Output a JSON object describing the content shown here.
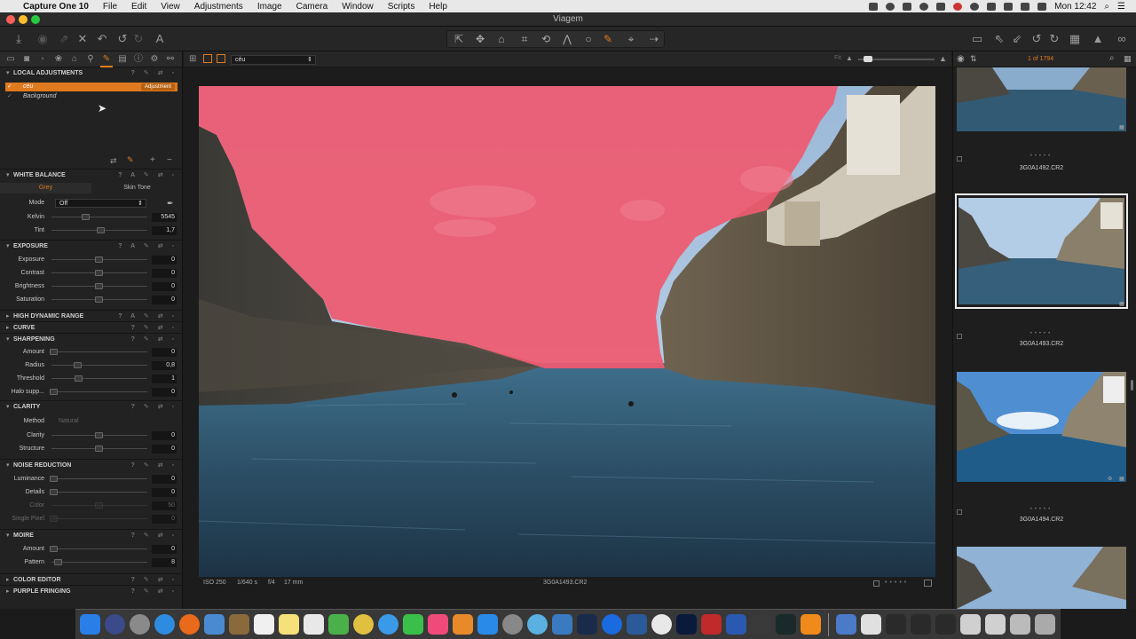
{
  "menubar": {
    "app_name": "Capture One 10",
    "items": [
      "File",
      "Edit",
      "View",
      "Adjustments",
      "Image",
      "Camera",
      "Window",
      "Scripts",
      "Help"
    ],
    "clock": "Mon 12:42"
  },
  "window": {
    "title": "Viagem"
  },
  "left_panel": {
    "local_adjustments": {
      "title": "LOCAL ADJUSTMENTS",
      "layers": [
        {
          "name": "céu",
          "tag": "Adjustment",
          "selected": true
        },
        {
          "name": "Background",
          "selected": false
        }
      ]
    },
    "white_balance": {
      "title": "WHITE BALANCE",
      "tabs": [
        "Grey",
        "Skin Tone"
      ],
      "mode_label": "Mode",
      "mode_value": "Off",
      "kelvin_label": "Kelvin",
      "kelvin_value": "5545",
      "tint_label": "Tint",
      "tint_value": "1,7"
    },
    "exposure": {
      "title": "EXPOSURE",
      "rows": [
        {
          "label": "Exposure",
          "value": "0"
        },
        {
          "label": "Contrast",
          "value": "0"
        },
        {
          "label": "Brightness",
          "value": "0"
        },
        {
          "label": "Saturation",
          "value": "0"
        }
      ]
    },
    "hdr": {
      "title": "HIGH DYNAMIC RANGE"
    },
    "curve": {
      "title": "CURVE"
    },
    "sharpening": {
      "title": "SHARPENING",
      "rows": [
        {
          "label": "Amount",
          "value": "0"
        },
        {
          "label": "Radius",
          "value": "0,8"
        },
        {
          "label": "Threshold",
          "value": "1"
        },
        {
          "label": "Halo supp...",
          "value": "0"
        }
      ]
    },
    "clarity": {
      "title": "CLARITY",
      "method_label": "Method",
      "method_value": "Natural",
      "rows": [
        {
          "label": "Clarity",
          "value": "0"
        },
        {
          "label": "Structure",
          "value": "0"
        }
      ]
    },
    "noise_reduction": {
      "title": "NOISE REDUCTION",
      "rows": [
        {
          "label": "Luminance",
          "value": "0"
        },
        {
          "label": "Details",
          "value": "0"
        },
        {
          "label": "Color",
          "value": "50"
        },
        {
          "label": "Single Pixel",
          "value": "0"
        }
      ]
    },
    "moire": {
      "title": "MOIRE",
      "rows": [
        {
          "label": "Amount",
          "value": "0"
        },
        {
          "label": "Pattern",
          "value": "8"
        }
      ]
    },
    "color_editor": {
      "title": "COLOR EDITOR"
    },
    "purple_fringing": {
      "title": "PURPLE FRINGING"
    }
  },
  "viewer": {
    "layer_select": "céu",
    "fit_label": "Fit",
    "footer_iso": "ISO 250",
    "footer_shutter": "1/640 s",
    "footer_aperture": "f/4",
    "footer_focal": "17 mm",
    "footer_filename": "3G0A1493.CR2"
  },
  "browser": {
    "count": "1 of 1794",
    "thumbs": [
      {
        "name": "3G0A1492.CR2"
      },
      {
        "name": "3G0A1493.CR2"
      },
      {
        "name": "3G0A1494.CR2"
      }
    ]
  },
  "colors": {
    "accent": "#e07a1e",
    "mask": "#ee5a70"
  }
}
